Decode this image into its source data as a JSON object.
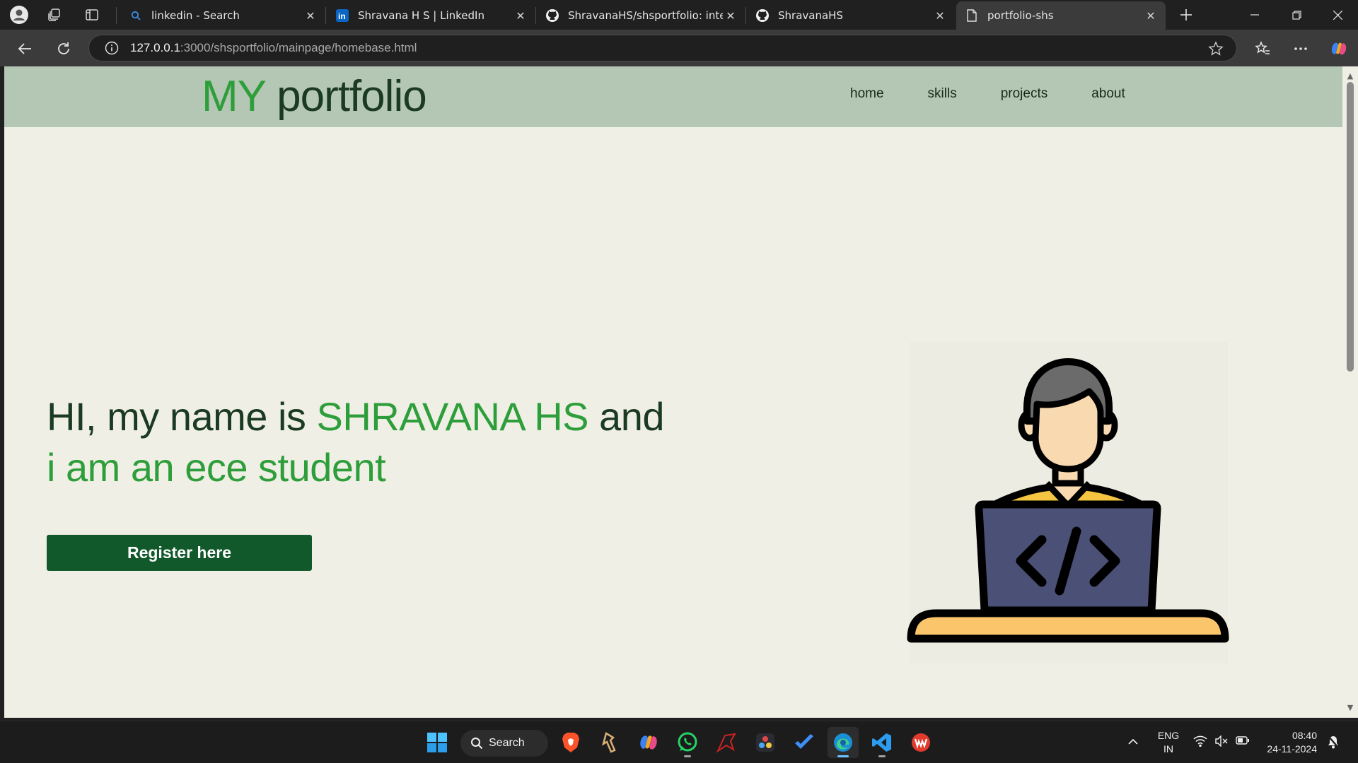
{
  "browser": {
    "tabs": [
      {
        "title": "linkedin - Search",
        "favicon": "search-icon",
        "active": false
      },
      {
        "title": "Shravana H S | LinkedIn",
        "favicon": "linkedin-icon",
        "active": false
      },
      {
        "title": "ShravanaHS/shsportfolio: interns",
        "favicon": "github-icon",
        "active": false
      },
      {
        "title": "ShravanaHS",
        "favicon": "github-icon",
        "active": false
      },
      {
        "title": "portfolio-shs",
        "favicon": "page-icon",
        "active": true
      }
    ],
    "address": {
      "host": "127.0.0.1",
      "path": ":3000/shsportfolio/mainpage/homebase.html"
    }
  },
  "page": {
    "logo": {
      "highlight": "MY",
      "rest": "portfolio"
    },
    "nav": [
      "home",
      "skills",
      "projects",
      "about"
    ],
    "hero": {
      "line1_prefix": "HI, my name is ",
      "name": "SHRAVANA HS",
      "line1_suffix": " and",
      "line2": "i am an ece student"
    },
    "register_label": "Register here",
    "illustration": "developer-at-laptop-illustration",
    "colors": {
      "header_bg": "#b4c6b4",
      "page_bg": "#efefe6",
      "accent_green": "#2e9e3a",
      "dark_green": "#11592a",
      "text_dark": "#1b3a22"
    }
  },
  "taskbar": {
    "search_label": "Search",
    "apps": [
      "windows-start-icon",
      "brave-icon",
      "tool-icon",
      "copilot-icon",
      "whatsapp-icon",
      "game-icon",
      "davinci-icon",
      "todo-icon",
      "edge-icon",
      "vscode-icon",
      "wps-icon"
    ],
    "language": {
      "line1": "ENG",
      "line2": "IN"
    },
    "time": "08:40",
    "date": "24-11-2024"
  }
}
